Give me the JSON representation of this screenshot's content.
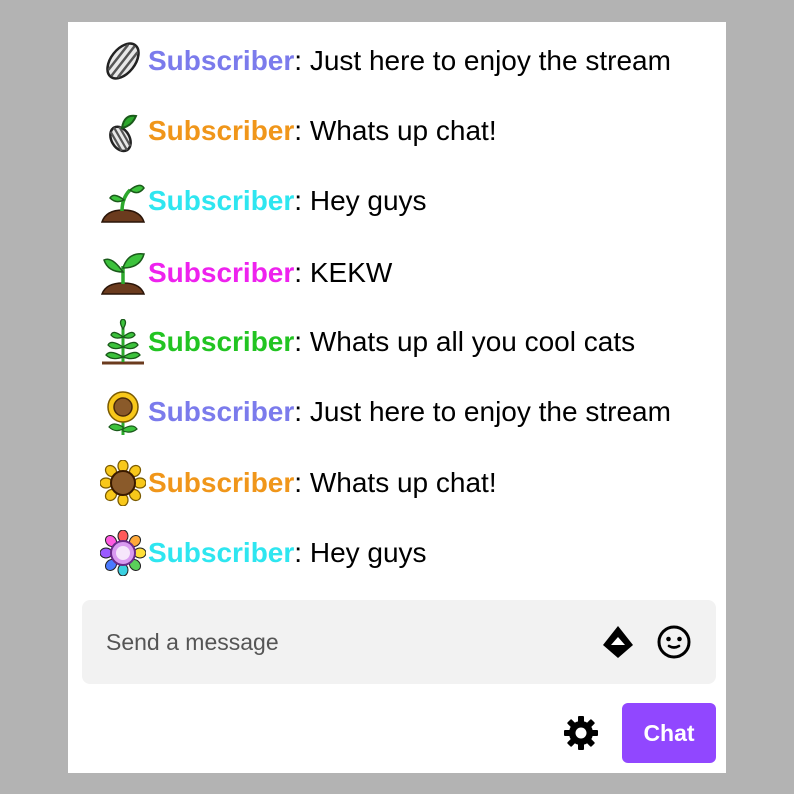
{
  "messages": [
    {
      "badge": "sunflower-seed-badge-icon",
      "username": "Subscriber",
      "user_color": "#7b7bec",
      "separator": ":",
      "text": " Just here to enjoy the stream"
    },
    {
      "badge": "sprouting-seed-badge-icon",
      "username": "Subscriber",
      "user_color": "#f0961a",
      "separator": ":",
      "text": " Whats up chat!"
    },
    {
      "badge": "seedling-badge-icon",
      "username": "Subscriber",
      "user_color": "#2ee6f0",
      "separator": ":",
      "text": " Hey guys"
    },
    {
      "badge": "young-plant-badge-icon",
      "username": "Subscriber",
      "user_color": "#ee22ee",
      "separator": ":",
      "text": " KEKW"
    },
    {
      "badge": "leafy-plant-badge-icon",
      "username": "Subscriber",
      "user_color": "#22c422",
      "separator": ":",
      "text": " Whats up all you cool cats"
    },
    {
      "badge": "sunflower-bud-badge-icon",
      "username": "Subscriber",
      "user_color": "#7b7bec",
      "separator": ":",
      "text": " Just here to enjoy the stream"
    },
    {
      "badge": "sunflower-badge-icon",
      "username": "Subscriber",
      "user_color": "#f0961a",
      "separator": ":",
      "text": " Whats up chat!"
    },
    {
      "badge": "rainbow-flower-badge-icon",
      "username": "Subscriber",
      "user_color": "#2ee6f0",
      "separator": ":",
      "text": " Hey guys"
    }
  ],
  "input": {
    "placeholder": "Send a message"
  },
  "icons": {
    "bits": "bits-diamond-icon",
    "emotes": "smiley-face-icon",
    "settings": "gear-icon"
  },
  "chat_button": {
    "label": "Chat",
    "color": "#9147ff"
  }
}
